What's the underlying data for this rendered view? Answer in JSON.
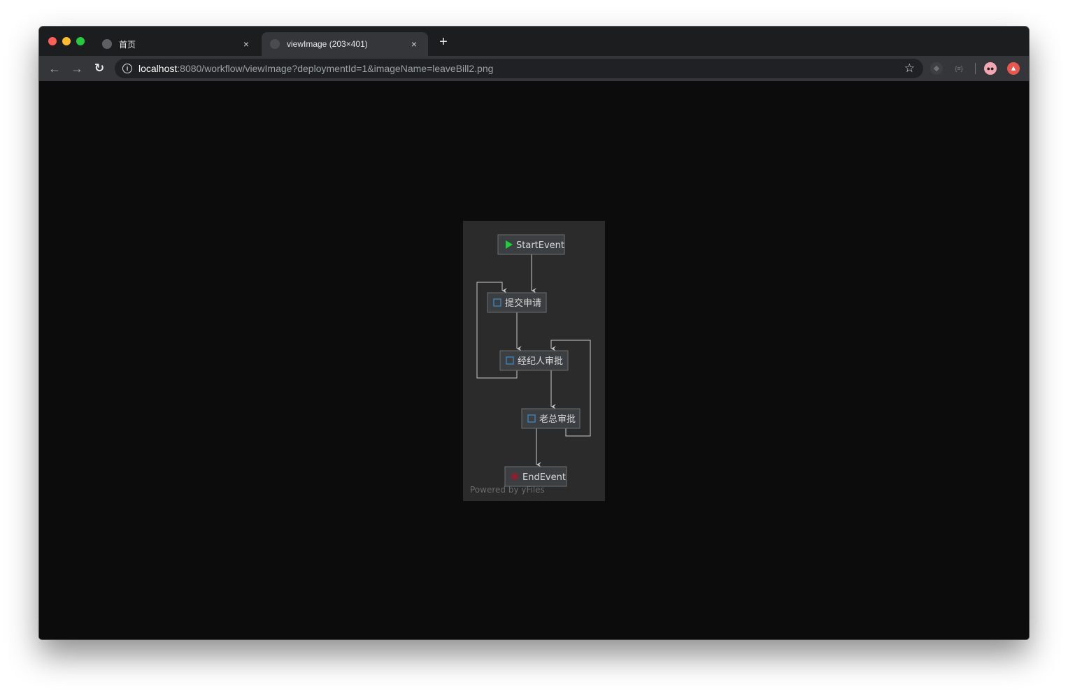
{
  "window": {
    "tabs": [
      {
        "title": "首页",
        "close": "×",
        "icon": "globe-icon",
        "active": false
      },
      {
        "title": "viewImage (203×401)",
        "close": "×",
        "icon": "globe-icon",
        "active": true
      }
    ],
    "new_tab": "+"
  },
  "toolbar": {
    "back": "←",
    "forward": "→",
    "reload": "↻",
    "info": "i",
    "url_host": "localhost",
    "url_rest": ":8080/workflow/viewImage?deploymentId=1&imageName=leaveBill2.png",
    "bookmark": "☆",
    "extensions": [
      "evernote-icon",
      "json-viewer-icon",
      "avatar-icon",
      "upload-icon"
    ]
  },
  "diagram": {
    "nodes": {
      "start": "StartEvent",
      "submit": "提交申请",
      "broker": "经纪人审批",
      "boss": "老总审批",
      "end": "EndEvent"
    },
    "watermark": "Powered by yFiles",
    "colors": {
      "background": "#2b2b2b",
      "node_fill": "#3c3f41",
      "node_border": "#6e6e6e",
      "text": "#d8d8d8",
      "edge": "#c8c8c8",
      "start_marker": "#1fcf3a",
      "task_marker": "#3d7eb0",
      "end_marker": "#8b1f2e"
    }
  }
}
